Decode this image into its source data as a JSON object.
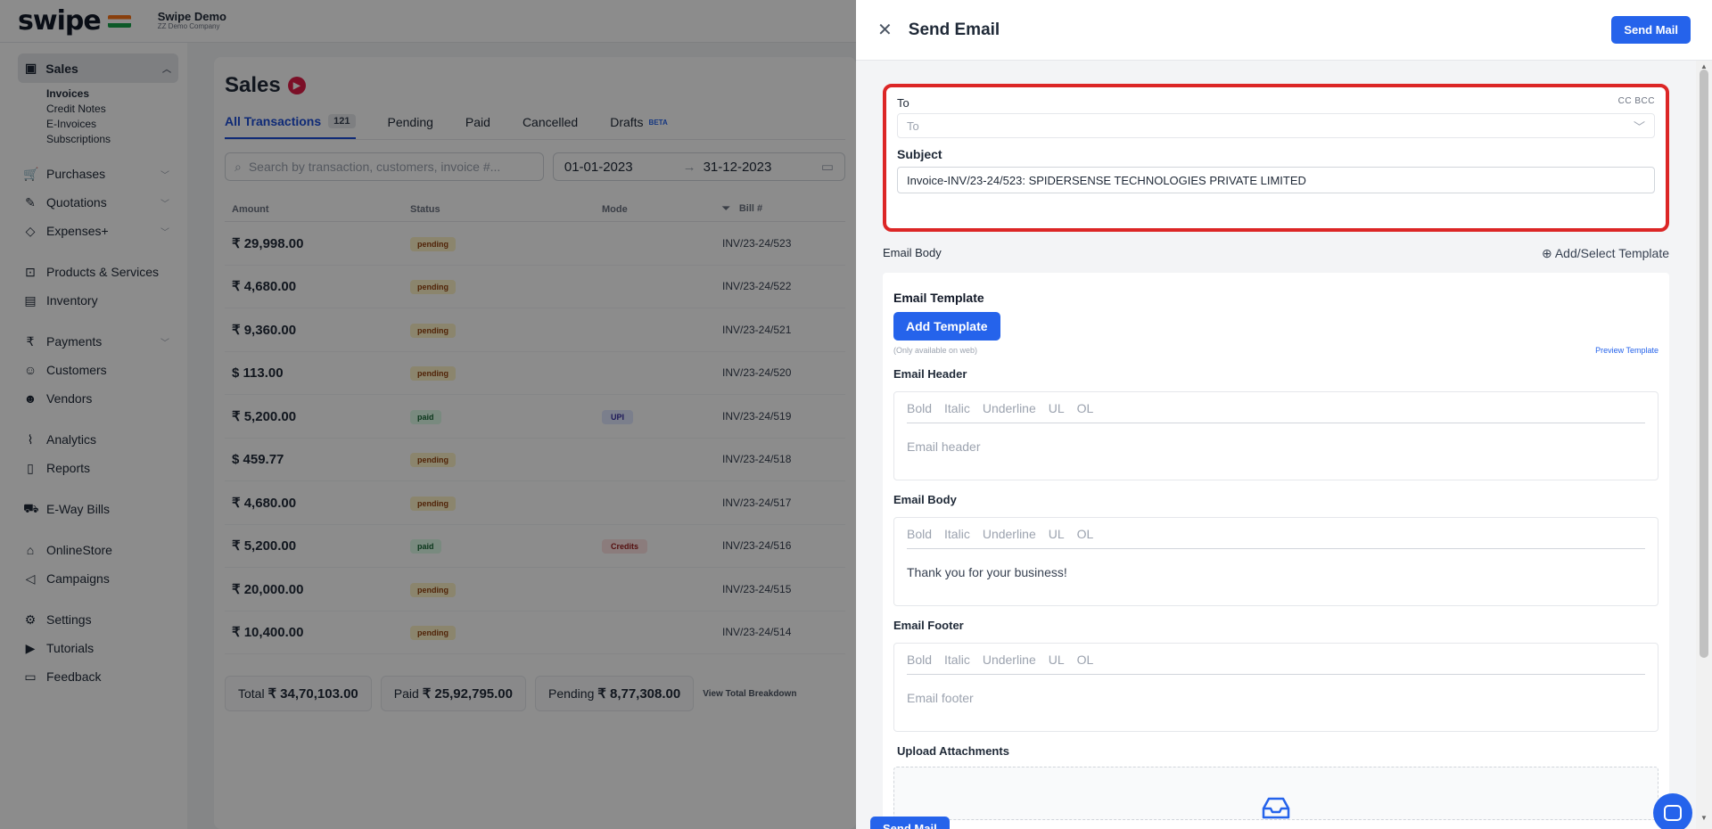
{
  "topbar": {
    "logo": "swipe",
    "company_name": "Swipe Demo",
    "company_sub": "ZZ Demo Company"
  },
  "sidebar": {
    "sales": {
      "label": "Sales",
      "subitems": [
        "Invoices",
        "Credit Notes",
        "E-Invoices",
        "Subscriptions"
      ]
    },
    "items": [
      {
        "label": "Purchases",
        "icon": "cart-icon"
      },
      {
        "label": "Quotations",
        "icon": "pen-icon"
      },
      {
        "label": "Expenses+",
        "icon": "tag-icon"
      },
      {
        "label": "Products & Services",
        "icon": "box-icon"
      },
      {
        "label": "Inventory",
        "icon": "inventory-icon"
      },
      {
        "label": "Payments",
        "icon": "rupee-icon"
      },
      {
        "label": "Customers",
        "icon": "user-icon"
      },
      {
        "label": "Vendors",
        "icon": "users-icon"
      },
      {
        "label": "Analytics",
        "icon": "analytics-icon"
      },
      {
        "label": "Reports",
        "icon": "report-icon"
      },
      {
        "label": "E-Way Bills",
        "icon": "truck-icon"
      },
      {
        "label": "OnlineStore",
        "icon": "store-icon"
      },
      {
        "label": "Campaigns",
        "icon": "megaphone-icon"
      },
      {
        "label": "Settings",
        "icon": "gear-icon"
      },
      {
        "label": "Tutorials",
        "icon": "video-icon"
      },
      {
        "label": "Feedback",
        "icon": "chat-icon"
      }
    ]
  },
  "sales": {
    "title": "Sales",
    "tabs": {
      "all": "All Transactions",
      "all_count": "121",
      "pending": "Pending",
      "paid": "Paid",
      "cancelled": "Cancelled",
      "drafts": "Drafts",
      "beta": "BETA"
    },
    "search_placeholder": "Search by transaction, customers, invoice #...",
    "date_from": "01-01-2023",
    "date_to": "31-12-2023",
    "columns": {
      "amount": "Amount",
      "status": "Status",
      "mode": "Mode",
      "bill": "Bill #"
    },
    "rows": [
      {
        "amount": "₹ 29,998.00",
        "status": "pending",
        "mode": "",
        "bill": "INV/23-24/523"
      },
      {
        "amount": "₹ 4,680.00",
        "status": "pending",
        "mode": "",
        "bill": "INV/23-24/522"
      },
      {
        "amount": "₹ 9,360.00",
        "status": "pending",
        "mode": "",
        "bill": "INV/23-24/521"
      },
      {
        "amount": "$ 113.00",
        "status": "pending",
        "mode": "",
        "bill": "INV/23-24/520"
      },
      {
        "amount": "₹ 5,200.00",
        "status": "paid",
        "mode": "UPI",
        "bill": "INV/23-24/519"
      },
      {
        "amount": "$ 459.77",
        "status": "pending",
        "mode": "",
        "bill": "INV/23-24/518"
      },
      {
        "amount": "₹ 4,680.00",
        "status": "pending",
        "mode": "",
        "bill": "INV/23-24/517"
      },
      {
        "amount": "₹ 5,200.00",
        "status": "paid",
        "mode": "Credits",
        "bill": "INV/23-24/516"
      },
      {
        "amount": "₹ 20,000.00",
        "status": "pending",
        "mode": "",
        "bill": "INV/23-24/515"
      },
      {
        "amount": "₹ 10,400.00",
        "status": "pending",
        "mode": "",
        "bill": "INV/23-24/514"
      }
    ],
    "totals": {
      "total_label": "Total",
      "total": "₹ 34,70,103.00",
      "paid_label": "Paid",
      "paid": "₹ 25,92,795.00",
      "pending_label": "Pending",
      "pending": "₹ 8,77,308.00",
      "breakdown": "View Total Breakdown"
    }
  },
  "drawer": {
    "title": "Send Email",
    "send_label": "Send Mail",
    "to_label": "To",
    "cc_bcc": "CC BCC",
    "to_placeholder": "To",
    "subject_label": "Subject",
    "subject_value": "Invoice-INV/23-24/523: SPIDERSENSE TECHNOLOGIES PRIVATE LIMITED",
    "email_body_label": "Email Body",
    "add_select_template": "Add/Select Template",
    "email_template_label": "Email Template",
    "add_template": "Add Template",
    "only_web": "(Only available on web)",
    "preview_template": "Preview Template",
    "toolbar": [
      "Bold",
      "Italic",
      "Underline",
      "UL",
      "OL"
    ],
    "header_label": "Email Header",
    "header_placeholder": "Email header",
    "body_label": "Email Body",
    "body_value": "Thank you for your business!",
    "footer_label": "Email Footer",
    "footer_placeholder": "Email footer",
    "upload_label": "Upload Attachments"
  },
  "colors": {
    "primary": "#2563eb",
    "highlight": "#dc2626"
  }
}
